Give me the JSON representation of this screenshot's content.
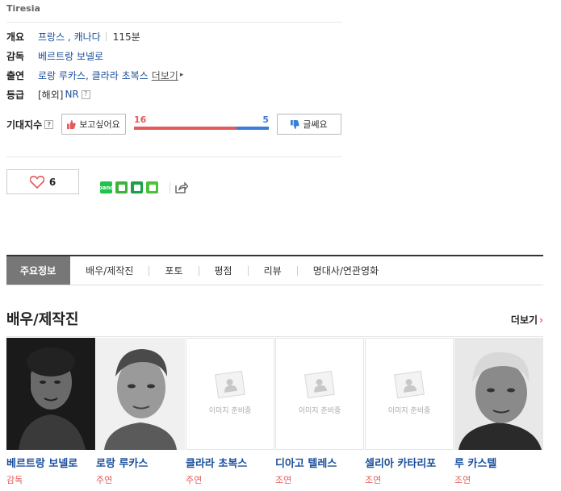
{
  "movie": {
    "original_title": "Tiresia",
    "info": {
      "overview_label": "개요",
      "countries": "프랑스 , 캐나다",
      "runtime": "115분",
      "director_label": "감독",
      "director": "베르트랑 보넬로",
      "cast_label": "출연",
      "cast": "로랑 루카스, 클라라 초복스",
      "cast_more": "더보기",
      "rating_label": "등급",
      "rating_region": "[해외]",
      "rating_value": "NR",
      "help_mark": "?"
    },
    "expectation": {
      "label": "기대지수",
      "want_label": "보고싶어요",
      "dont_label": "글쎄요",
      "want_count": "16",
      "dont_count": "5",
      "want_share": 0.762
    },
    "like": {
      "count": "6"
    }
  },
  "share_icons": [
    {
      "name": "band-icon",
      "color": "#21c44b",
      "text": "band"
    },
    {
      "name": "talk-icon",
      "color": "#3db33d",
      "text": ""
    },
    {
      "name": "bookmark-icon",
      "color": "#1aa24a",
      "text": ""
    },
    {
      "name": "memo-icon",
      "color": "#4dc23c",
      "text": ""
    }
  ],
  "tabs": [
    {
      "label": "주요정보",
      "active": true
    },
    {
      "label": "배우/제작진"
    },
    {
      "label": "포토"
    },
    {
      "label": "평점"
    },
    {
      "label": "리뷰"
    },
    {
      "label": "명대사/연관영화"
    }
  ],
  "cast_section": {
    "title": "배우/제작진",
    "more": "더보기",
    "placeholder_text": "이미지 준비중",
    "people": [
      {
        "name": "베르트랑 보넬로",
        "role": "감독",
        "photo": "dark"
      },
      {
        "name": "로랑 루카스",
        "role": "주연",
        "photo": "bw-face"
      },
      {
        "name": "클라라 초복스",
        "role": "주연",
        "photo": "placeholder"
      },
      {
        "name": "디아고 텔레스",
        "role": "조연",
        "photo": "placeholder"
      },
      {
        "name": "셀리아 카타리포",
        "role": "조연",
        "photo": "placeholder"
      },
      {
        "name": "루 카스텔",
        "role": "조연",
        "photo": "bw-old"
      }
    ]
  }
}
